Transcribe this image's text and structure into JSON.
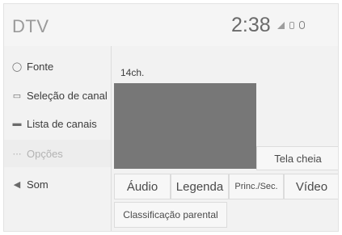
{
  "header": {
    "title": "DTV",
    "clock": "2:38",
    "icons": [
      "signal-icon",
      "phone-icon",
      "bluetooth-icon"
    ]
  },
  "sidebar": {
    "items": [
      {
        "label": "Fonte",
        "icon": "source-icon",
        "enabled": true
      },
      {
        "label": "Seleção de canal",
        "icon": "monitor-icon",
        "enabled": true
      },
      {
        "label": "Lista de canais",
        "icon": "channel-list-icon",
        "enabled": true
      },
      {
        "label": "Opções",
        "icon": "options-icon",
        "enabled": false
      },
      {
        "label": "Som",
        "icon": "speaker-icon",
        "enabled": true
      }
    ]
  },
  "main": {
    "channel": "14ch.",
    "buttons": {
      "fullscreen": "Tela cheia",
      "audio": "Áudio",
      "caption": "Legenda",
      "princ_sec": "Princ./Sec.",
      "video": "Vídeo",
      "parental": "Classificação parental"
    }
  },
  "colors": {
    "background": "#f2f2f2",
    "video_area": "#777777",
    "disabled_text": "#b3b3b3"
  }
}
